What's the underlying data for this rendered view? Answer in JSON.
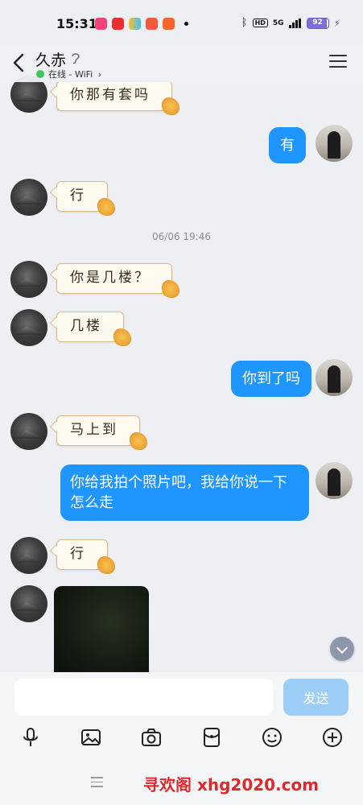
{
  "status_bar": {
    "time": "15:31",
    "battery": "92",
    "network": "5G",
    "hd": "HD"
  },
  "header": {
    "contact_name": "久赤",
    "status": "在线 - WiFi",
    "status_chevron": "›"
  },
  "messages": [
    {
      "from": "them",
      "type": "text",
      "text": "你那有套吗"
    },
    {
      "from": "me",
      "type": "text",
      "text": "有"
    },
    {
      "from": "them",
      "type": "text",
      "text": "行"
    },
    {
      "from": "system",
      "type": "timestamp",
      "text": "06/06 19:46"
    },
    {
      "from": "them",
      "type": "text",
      "text": "你是几楼？"
    },
    {
      "from": "them",
      "type": "text",
      "text": "几楼"
    },
    {
      "from": "me",
      "type": "text",
      "text": "你到了吗"
    },
    {
      "from": "them",
      "type": "text",
      "text": "马上到"
    },
    {
      "from": "me",
      "type": "text",
      "text": "你给我拍个照片吧，我给你说一下怎么走"
    },
    {
      "from": "them",
      "type": "text",
      "text": "行"
    },
    {
      "from": "them",
      "type": "image",
      "text": ""
    }
  ],
  "composer": {
    "placeholder": "",
    "send_label": "发送"
  },
  "toolbar_icons": [
    "microphone-icon",
    "image-icon",
    "camera-icon",
    "red-packet-icon",
    "emoji-icon",
    "plus-icon"
  ],
  "watermark": "寻欢阁 xhg2020.com",
  "colors": {
    "my_bubble": "#1e95ff",
    "their_bubble_bg": "#fffaf0",
    "their_bubble_border": "#d9b98a",
    "online": "#3cc85a",
    "send_disabled": "#9ccdf7",
    "watermark": "#e3262b"
  }
}
